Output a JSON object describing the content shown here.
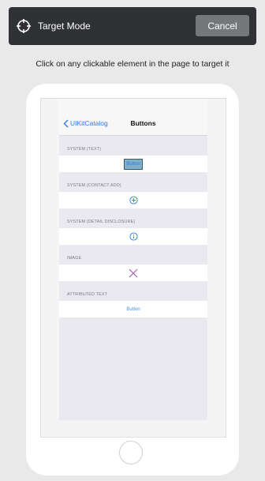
{
  "header": {
    "title": "Target Mode",
    "cancel_label": "Cancel",
    "icon": "crosshair-icon"
  },
  "instruction": "Click on any clickable element in the page to target it",
  "device": {
    "nav": {
      "back_label": "UIKitCatalog",
      "title": "Buttons"
    },
    "sections": [
      {
        "header": "SYSTEM (TEXT)",
        "content": "Button"
      },
      {
        "header": "SYSTEM (CONTACT ADD)",
        "icon": "plus-circle-icon"
      },
      {
        "header": "SYSTEM (DETAIL DISCLOSURE)",
        "icon": "info-circle-icon"
      },
      {
        "header": "IMAGE",
        "icon": "x-icon"
      },
      {
        "header": "ATTRIBUTED TEXT",
        "content": "Button"
      }
    ]
  },
  "colors": {
    "topbar": "#2f3135",
    "cancel_button": "#75777b",
    "tint": "#2f7ae5",
    "image_tint": "#9b59b6"
  }
}
